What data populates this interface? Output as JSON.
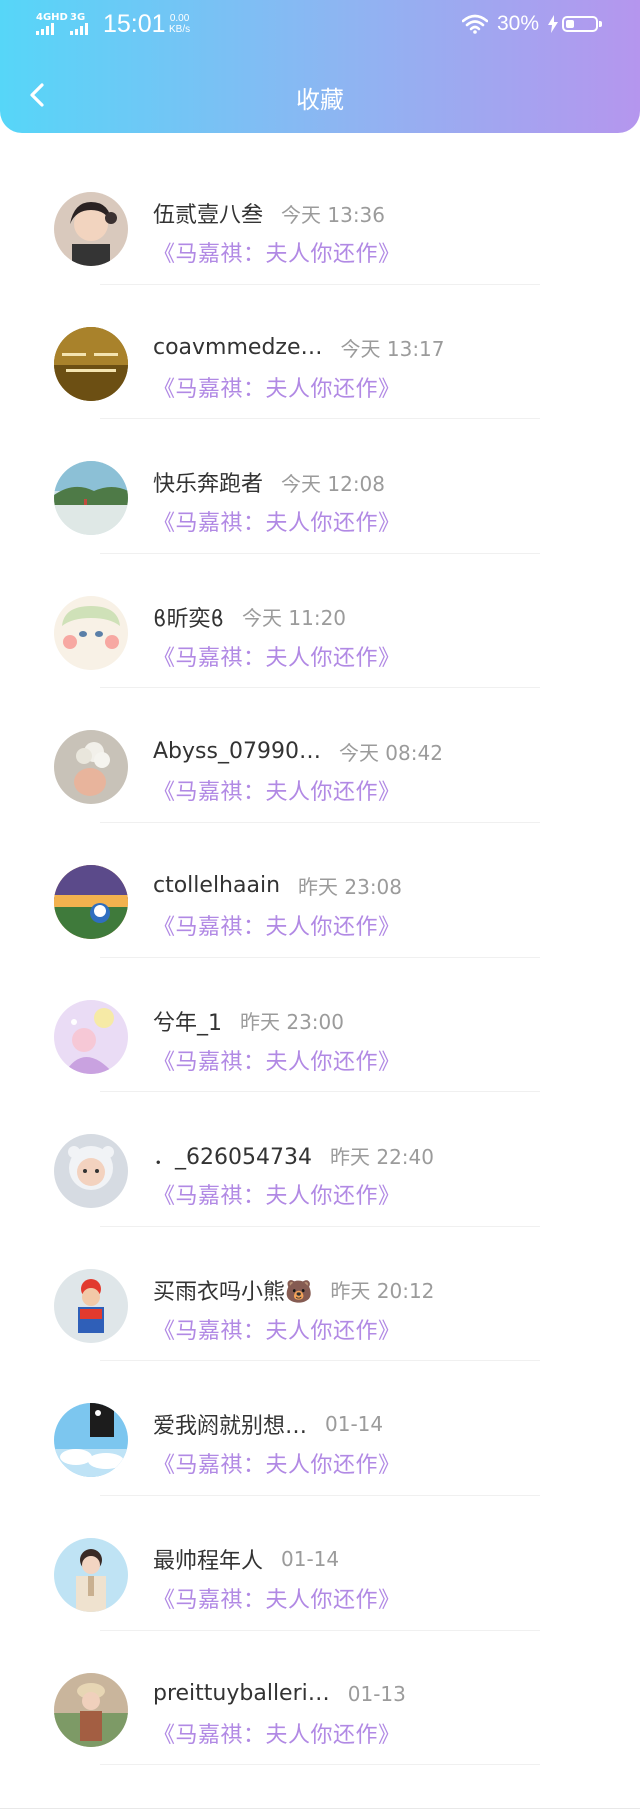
{
  "status_bar": {
    "network_1": "4GHD",
    "network_2": "3G",
    "time": "15:01",
    "speed_value": "0.00",
    "speed_unit": "KB/s",
    "battery": "30%"
  },
  "header": {
    "title": "收藏",
    "back_icon": "chevron-left-icon"
  },
  "colors": {
    "gradient_start": "#56d6f8",
    "gradient_end": "#b596ee",
    "accent_purple": "#b189e4",
    "username_text": "#333333",
    "time_text": "#9b9b9b"
  },
  "favorites": [
    {
      "username": "伍贰壹八叁",
      "time": "今天 13:36",
      "work_title": "《马嘉祺：夫人你还作》"
    },
    {
      "username": "coavmmedze…",
      "time": "今天 13:17",
      "work_title": "《马嘉祺：夫人你还作》"
    },
    {
      "username": "快乐奔跑者",
      "time": "今天 12:08",
      "work_title": "《马嘉祺：夫人你还作》"
    },
    {
      "username": "ϐ昕奕ϐ",
      "time": "今天 11:20",
      "work_title": "《马嘉祺：夫人你还作》"
    },
    {
      "username": "Abyss_07990…",
      "time": "今天 08:42",
      "work_title": "《马嘉祺：夫人你还作》"
    },
    {
      "username": "ctollelhaain",
      "time": "昨天 23:08",
      "work_title": "《马嘉祺：夫人你还作》"
    },
    {
      "username": "兮年_1",
      "time": "昨天 23:00",
      "work_title": "《马嘉祺：夫人你还作》"
    },
    {
      "username": "．_626054734",
      "time": "昨天 22:40",
      "work_title": "《马嘉祺：夫人你还作》"
    },
    {
      "username": "买雨衣吗小熊🐻",
      "time": "昨天 20:12",
      "work_title": "《马嘉祺：夫人你还作》"
    },
    {
      "username": "爱我阏就别想…",
      "time": "01-14",
      "work_title": "《马嘉祺：夫人你还作》"
    },
    {
      "username": "最帅程年人",
      "time": "01-14",
      "work_title": "《马嘉祺：夫人你还作》"
    },
    {
      "username": "preittuyballeri…",
      "time": "01-13",
      "work_title": "《马嘉祺：夫人你还作》"
    }
  ]
}
